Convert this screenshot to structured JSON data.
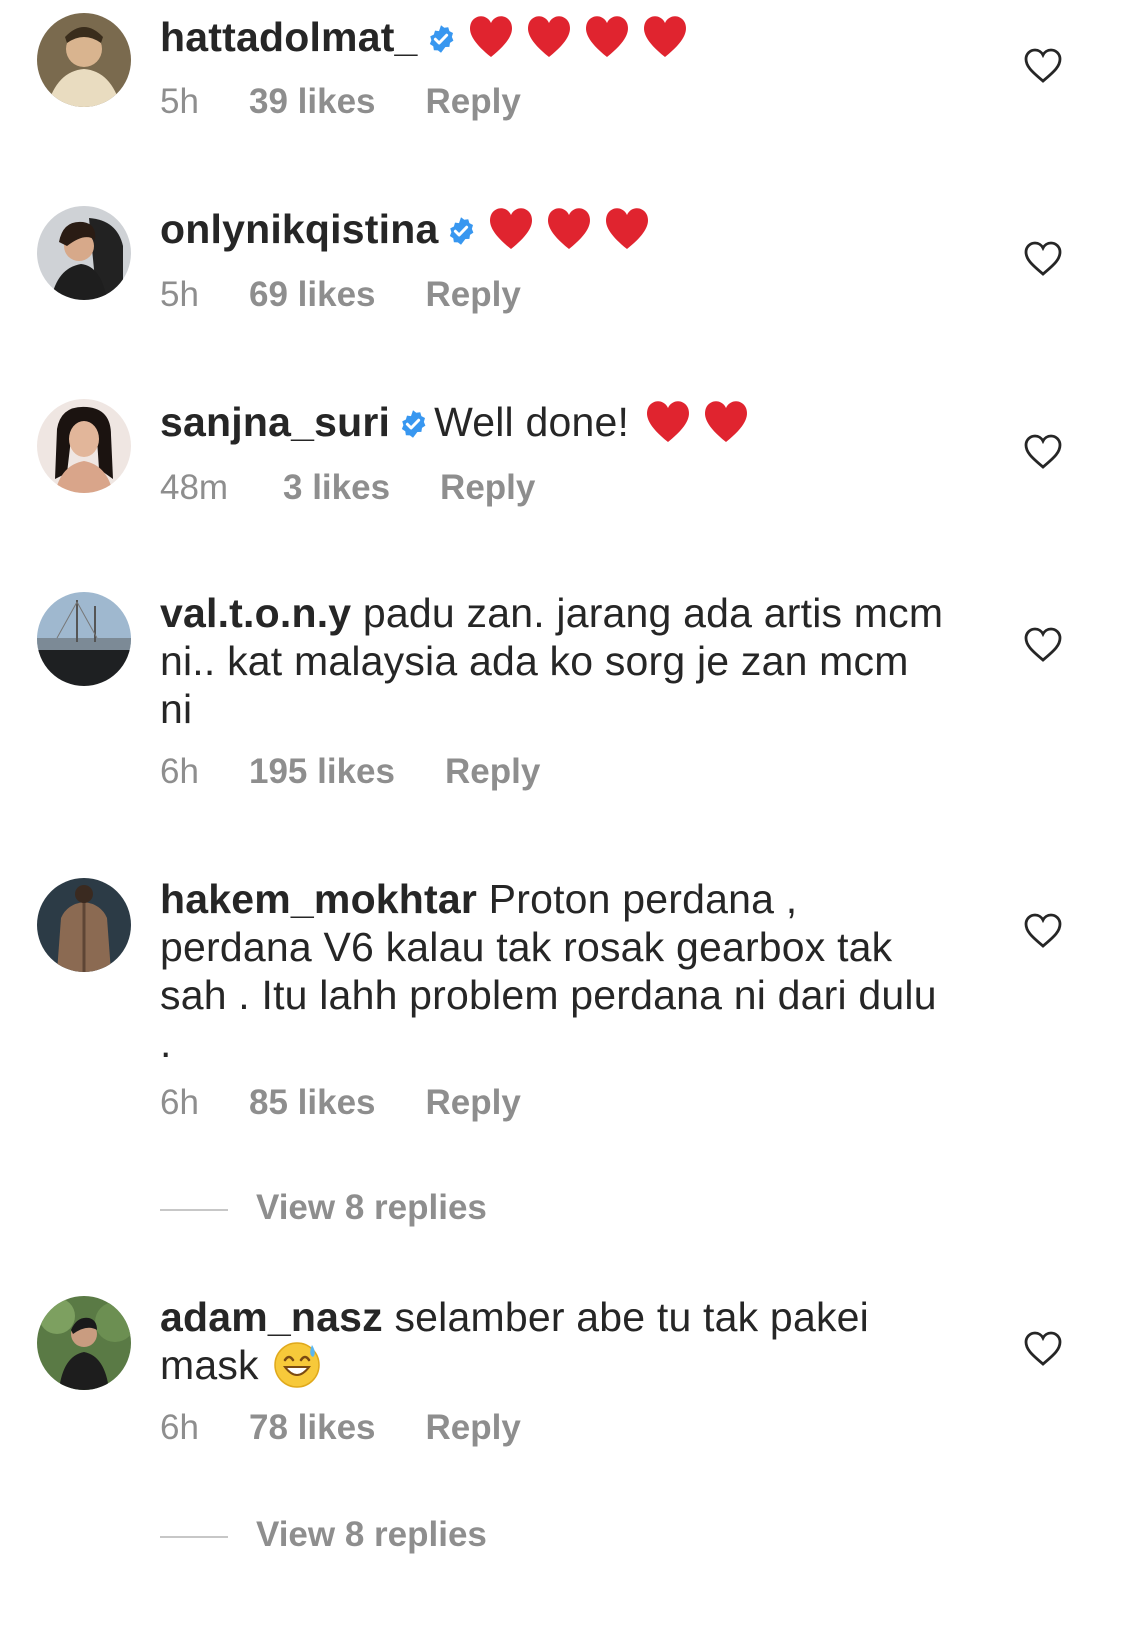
{
  "comments": [
    {
      "username": "hattadolmat_",
      "verified": true,
      "text": "",
      "emoji": "hearts-4",
      "time": "5h",
      "likes": "39 likes",
      "reply": "Reply"
    },
    {
      "username": "onlynikqistina",
      "verified": true,
      "text": "",
      "emoji": "hearts-3",
      "time": "5h",
      "likes": "69 likes",
      "reply": "Reply"
    },
    {
      "username": "sanjna_suri",
      "verified": true,
      "text": "Well done!",
      "emoji": "hearts-2",
      "time": "48m",
      "likes": "3 likes",
      "reply": "Reply"
    },
    {
      "username": "val.t.o.n.y",
      "verified": false,
      "text": "padu zan. jarang ada artis mcm ni.. kat malaysia ada ko sorg je zan mcm ni",
      "time": "6h",
      "likes": "195 likes",
      "reply": "Reply"
    },
    {
      "username": "hakem_mokhtar",
      "verified": false,
      "text": "Proton perdana , perdana V6 kalau tak rosak gearbox tak sah . Itu lahh problem perdana ni dari dulu .",
      "time": "6h",
      "likes": "85 likes",
      "reply": "Reply",
      "view_replies": "View 8 replies"
    },
    {
      "username": "adam_nasz",
      "verified": false,
      "text": "selamber abe tu tak pakei mask",
      "emoji": "grinning-sweat",
      "time": "6h",
      "likes": "78 likes",
      "reply": "Reply",
      "view_replies": "View 8 replies"
    }
  ],
  "icons": {
    "like": "heart-outline-icon",
    "verified": "verified-badge-icon"
  },
  "colors": {
    "text": "#262626",
    "meta": "#8e8e8e",
    "verified": "#3897f0",
    "heart": "#e0242f"
  }
}
